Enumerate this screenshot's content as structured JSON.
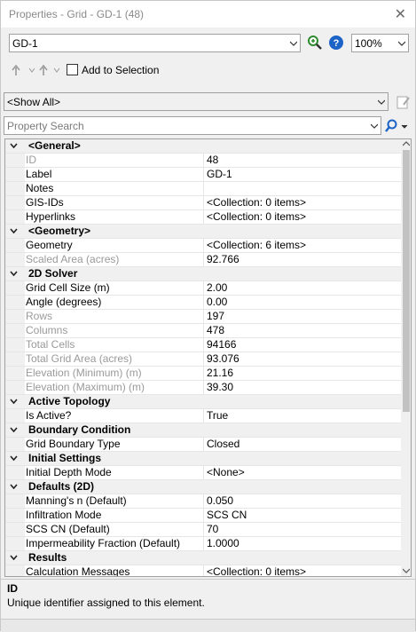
{
  "window": {
    "title": "Properties - Grid - GD-1 (48)"
  },
  "toolbar": {
    "element_selector": {
      "value": "GD-1"
    },
    "zoom": {
      "value": "100%"
    },
    "add_to_selection": {
      "label": "Add to Selection",
      "checked": false
    },
    "filter": {
      "value": "<Show All>"
    },
    "search": {
      "placeholder": "Property Search"
    }
  },
  "properties": [
    {
      "type": "category",
      "label": "<General>"
    },
    {
      "type": "property",
      "name": "ID",
      "value": "48",
      "readonly": true
    },
    {
      "type": "property",
      "name": "Label",
      "value": "GD-1",
      "readonly": false
    },
    {
      "type": "property",
      "name": "Notes",
      "value": "",
      "readonly": false
    },
    {
      "type": "property",
      "name": "GIS-IDs",
      "value": "<Collection: 0 items>",
      "readonly": false
    },
    {
      "type": "property",
      "name": "Hyperlinks",
      "value": "<Collection: 0 items>",
      "readonly": false
    },
    {
      "type": "category",
      "label": "<Geometry>"
    },
    {
      "type": "property",
      "name": "Geometry",
      "value": "<Collection: 6 items>",
      "readonly": false
    },
    {
      "type": "property",
      "name": "Scaled Area (acres)",
      "value": "92.766",
      "readonly": true
    },
    {
      "type": "category",
      "label": "2D Solver"
    },
    {
      "type": "property",
      "name": "Grid Cell Size (m)",
      "value": "2.00",
      "readonly": false
    },
    {
      "type": "property",
      "name": "Angle (degrees)",
      "value": "0.00",
      "readonly": false
    },
    {
      "type": "property",
      "name": "Rows",
      "value": "197",
      "readonly": true
    },
    {
      "type": "property",
      "name": "Columns",
      "value": "478",
      "readonly": true
    },
    {
      "type": "property",
      "name": "Total Cells",
      "value": "94166",
      "readonly": true
    },
    {
      "type": "property",
      "name": "Total Grid Area (acres)",
      "value": "93.076",
      "readonly": true
    },
    {
      "type": "property",
      "name": "Elevation (Minimum) (m)",
      "value": "21.16",
      "readonly": true
    },
    {
      "type": "property",
      "name": "Elevation (Maximum) (m)",
      "value": "39.30",
      "readonly": true
    },
    {
      "type": "category",
      "label": "Active Topology"
    },
    {
      "type": "property",
      "name": "Is Active?",
      "value": "True",
      "readonly": false
    },
    {
      "type": "category",
      "label": "Boundary Condition"
    },
    {
      "type": "property",
      "name": "Grid Boundary Type",
      "value": "Closed",
      "readonly": false
    },
    {
      "type": "category",
      "label": "Initial Settings"
    },
    {
      "type": "property",
      "name": "Initial Depth Mode",
      "value": "<None>",
      "readonly": false
    },
    {
      "type": "category",
      "label": "Defaults (2D)"
    },
    {
      "type": "property",
      "name": "Manning's n (Default)",
      "value": "0.050",
      "readonly": false
    },
    {
      "type": "property",
      "name": "Infiltration Mode",
      "value": "SCS CN",
      "readonly": false
    },
    {
      "type": "property",
      "name": "SCS CN (Default)",
      "value": "70",
      "readonly": false
    },
    {
      "type": "property",
      "name": "Impermeability Fraction (Default)",
      "value": "1.0000",
      "readonly": false
    },
    {
      "type": "category",
      "label": "Results"
    },
    {
      "type": "property",
      "name": "Calculation Messages",
      "value": "<Collection: 0 items>",
      "readonly": false
    }
  ],
  "description": {
    "title": "ID",
    "text": "Unique identifier assigned to this element."
  },
  "icons": {
    "zoom_to": "zoom-in-icon",
    "help": "help-icon",
    "undo": "undo-icon",
    "redo": "redo-icon",
    "filter_side": "edit-icon",
    "search_go": "search-icon"
  },
  "colors": {
    "help_blue": "#1c63c7",
    "zoom_green": "#2e8b2e",
    "readonly_text": "#9a9a9a",
    "category_bg": "#f0f0f0"
  }
}
